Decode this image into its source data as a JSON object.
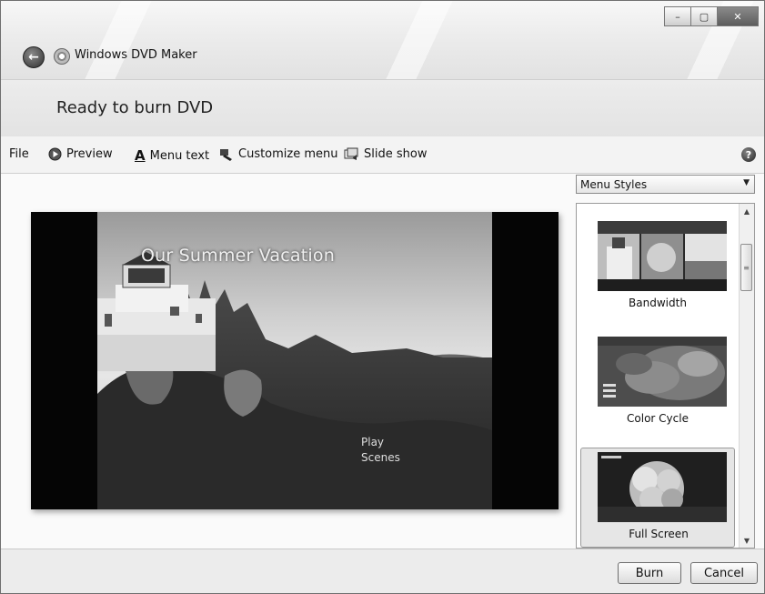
{
  "window": {
    "title": "Windows DVD Maker",
    "controls": {
      "minimize": "–",
      "maximize": "▢",
      "close": "✕"
    }
  },
  "header": {
    "heading": "Ready to burn DVD"
  },
  "toolbar": {
    "file": "File",
    "preview": "Preview",
    "menu_text": "Menu text",
    "customize_menu": "Customize menu",
    "slide_show": "Slide show",
    "help": "?"
  },
  "preview": {
    "menu_title": "Our Summer Vacation",
    "play": "Play",
    "scenes": "Scenes"
  },
  "menu_styles": {
    "selected": "Menu Styles",
    "items": [
      {
        "label": "Bandwidth",
        "selected": false
      },
      {
        "label": "Color Cycle",
        "selected": false
      },
      {
        "label": "Full Screen",
        "selected": true
      }
    ]
  },
  "footer": {
    "burn": "Burn",
    "cancel": "Cancel"
  }
}
